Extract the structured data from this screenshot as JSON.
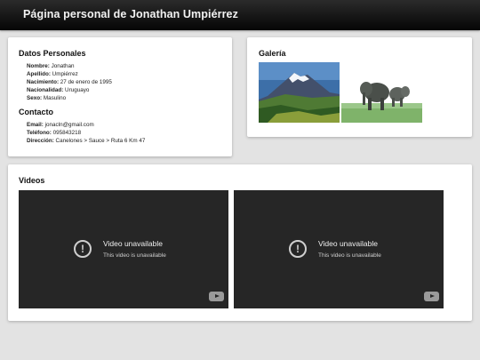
{
  "header": {
    "title": "Página personal de Jonathan Umpiérrez"
  },
  "personal": {
    "heading": "Datos Personales",
    "rows": [
      {
        "label": "Nombre:",
        "value": " Jonathan"
      },
      {
        "label": "Apellido:",
        "value": " Umpiérrez"
      },
      {
        "label": "Nacimiento:",
        "value": " 27 de enero de 1995"
      },
      {
        "label": "Nacionalidad:",
        "value": " Uruguayo"
      },
      {
        "label": "Sexo:",
        "value": " Masulino"
      }
    ]
  },
  "contact": {
    "heading": "Contacto",
    "rows": [
      {
        "label": "Email:",
        "value": " jonacln@gmail.com"
      },
      {
        "label": "Teléfono:",
        "value": " 095843218"
      },
      {
        "label": "Dirección:",
        "value": " Canelones > Sauce > Ruta 6 Km 47"
      }
    ]
  },
  "gallery": {
    "heading": "Galería"
  },
  "videos": {
    "heading": "Videos",
    "items": [
      {
        "title": "Video unavailable",
        "subtitle": "This video is unavailable"
      },
      {
        "title": "Video unavailable",
        "subtitle": "This video is unavailable"
      }
    ]
  },
  "icons": [
    "alert-circle-icon",
    "youtube-icon"
  ]
}
